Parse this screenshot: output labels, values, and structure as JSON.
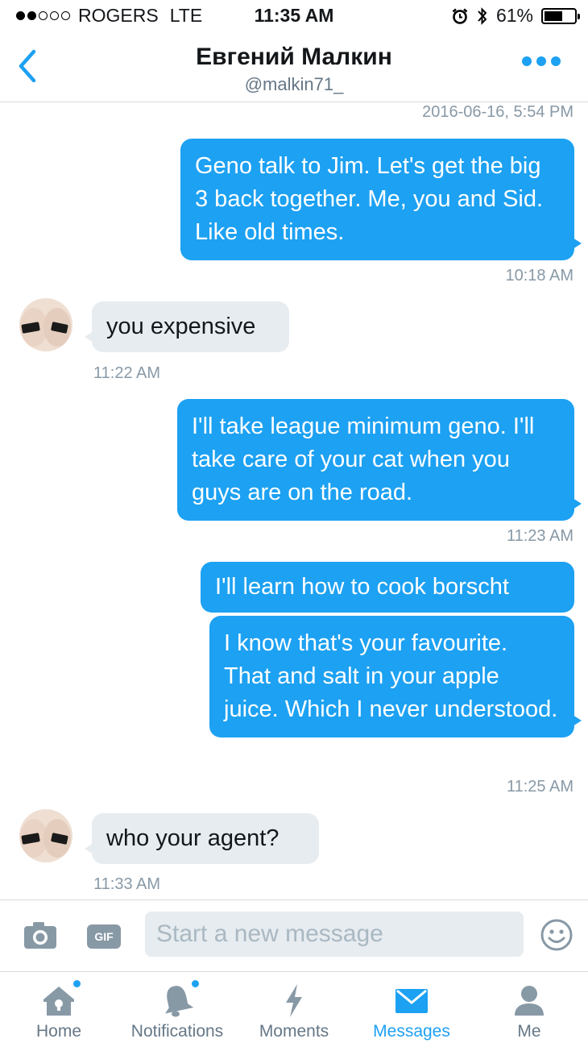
{
  "status_bar": {
    "carrier": "ROGERS",
    "network": "LTE",
    "time": "11:35 AM",
    "battery": "61%",
    "battery_level": 0.61,
    "signal_bars": 2
  },
  "header": {
    "name": "Евгений Малкин",
    "handle": "@malkin71_"
  },
  "conversation": {
    "top_timestamp": "2016-06-16, 5:54 PM",
    "messages": [
      {
        "direction": "sent",
        "text": "Geno talk to Jim. Let's get the big 3 back together. Me, you and Sid. Like old times.",
        "time": "10:18 AM"
      },
      {
        "direction": "received",
        "text": "you expensive",
        "time": "11:22 AM"
      },
      {
        "direction": "sent",
        "text": "I'll take league minimum geno. I'll take care of your cat when you guys are on the road.",
        "time": "11:23 AM"
      },
      {
        "direction": "sent",
        "text": "I'll learn how to cook borscht"
      },
      {
        "direction": "sent",
        "text": "I know that's your favourite. That and salt in your apple juice. Which I never understood.",
        "time": "11:25 AM"
      },
      {
        "direction": "received",
        "text": "who your agent?",
        "time": "11:33 AM"
      }
    ]
  },
  "composer": {
    "camera_icon": "camera-icon",
    "gif_label": "GIF",
    "placeholder": "Start a new message",
    "emoji_icon": "emoji-icon"
  },
  "tabs": [
    {
      "label": "Home",
      "icon": "home-icon",
      "has_badge": true
    },
    {
      "label": "Notifications",
      "icon": "bell-icon",
      "has_badge": true
    },
    {
      "label": "Moments",
      "icon": "lightning-icon"
    },
    {
      "label": "Messages",
      "icon": "envelope-icon",
      "active": true
    },
    {
      "label": "Me",
      "icon": "person-icon"
    }
  ],
  "colors": {
    "accent": "#1da1f2",
    "received_bubble": "#e6ecf0",
    "secondary_text": "#657786"
  }
}
